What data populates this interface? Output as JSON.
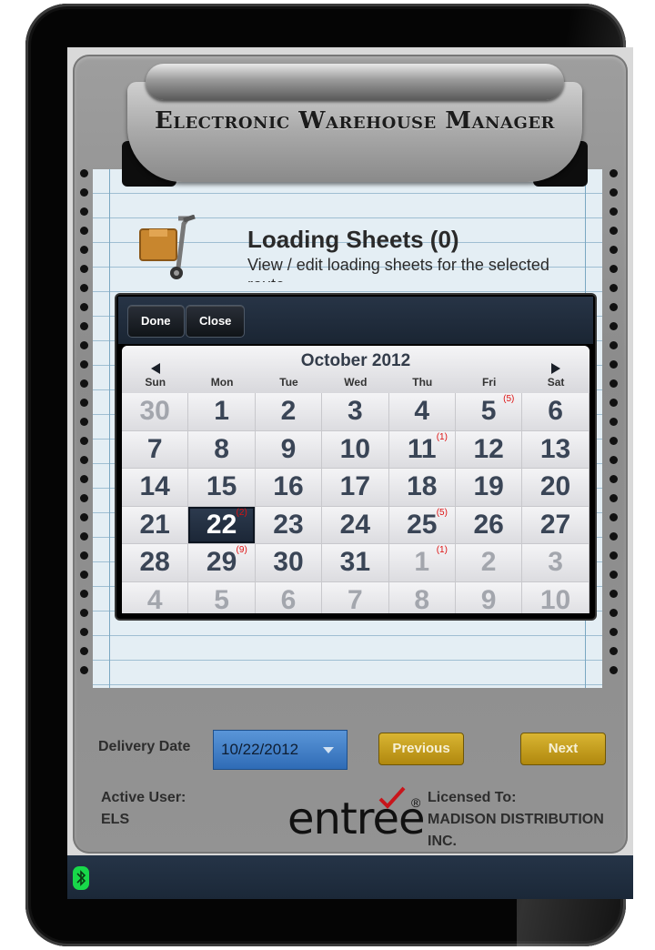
{
  "app": {
    "title": "Electronic Warehouse Manager"
  },
  "loading_sheets": {
    "title": "Loading Sheets (0)",
    "description": "View / edit loading sheets for the selected route"
  },
  "date_picker": {
    "done_label": "Done",
    "close_label": "Close",
    "month_title": "October 2012",
    "weekdays": [
      "Sun",
      "Mon",
      "Tue",
      "Wed",
      "Thu",
      "Fri",
      "Sat"
    ],
    "weeks": [
      [
        {
          "d": "30",
          "dim": true
        },
        {
          "d": "1"
        },
        {
          "d": "2"
        },
        {
          "d": "3"
        },
        {
          "d": "4"
        },
        {
          "d": "5",
          "badge": "(5)"
        },
        {
          "d": "6"
        }
      ],
      [
        {
          "d": "7"
        },
        {
          "d": "8"
        },
        {
          "d": "9"
        },
        {
          "d": "10"
        },
        {
          "d": "11",
          "badge": "(1)"
        },
        {
          "d": "12"
        },
        {
          "d": "13"
        }
      ],
      [
        {
          "d": "14"
        },
        {
          "d": "15"
        },
        {
          "d": "16"
        },
        {
          "d": "17"
        },
        {
          "d": "18"
        },
        {
          "d": "19"
        },
        {
          "d": "20"
        }
      ],
      [
        {
          "d": "21"
        },
        {
          "d": "22",
          "badge": "(2)",
          "selected": true
        },
        {
          "d": "23"
        },
        {
          "d": "24"
        },
        {
          "d": "25",
          "badge": "(5)"
        },
        {
          "d": "26"
        },
        {
          "d": "27"
        }
      ],
      [
        {
          "d": "28"
        },
        {
          "d": "29",
          "badge": "(9)"
        },
        {
          "d": "30"
        },
        {
          "d": "31"
        },
        {
          "d": "1",
          "dim": true,
          "badge": "(1)"
        },
        {
          "d": "2",
          "dim": true
        },
        {
          "d": "3",
          "dim": true
        }
      ],
      [
        {
          "d": "4",
          "dim": true
        },
        {
          "d": "5",
          "dim": true
        },
        {
          "d": "6",
          "dim": true
        },
        {
          "d": "7",
          "dim": true
        },
        {
          "d": "8",
          "dim": true
        },
        {
          "d": "9",
          "dim": true
        },
        {
          "d": "10",
          "dim": true
        }
      ]
    ]
  },
  "footer": {
    "delivery_date_label": "Delivery Date",
    "delivery_date_value": "10/22/2012",
    "previous_label": "Previous",
    "next_label": "Next",
    "active_user_label": "Active User:",
    "active_user_value": "ELS",
    "licensed_to_label": "Licensed To:",
    "licensed_to_line1": "MADISON DISTRIBUTION",
    "licensed_to_line2": "INC.",
    "logo_text": "entree",
    "logo_reg": "®"
  },
  "colors": {
    "accent_gold": "#c49d1f",
    "date_select_blue": "#3f7fc6",
    "header_dark": "#1e2a3a",
    "badge_red": "#dd1111",
    "bluetooth_green": "#18d84a"
  },
  "icons": {
    "cart": "hand-truck-icon",
    "bluetooth": "bluetooth-icon",
    "prev_month": "triangle-left-icon",
    "next_month": "triangle-right-icon"
  }
}
